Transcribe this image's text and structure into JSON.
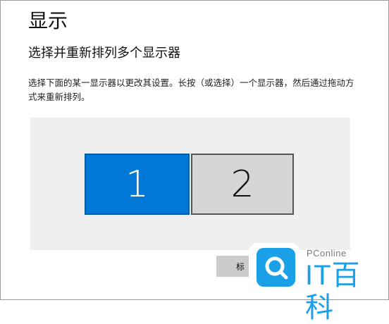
{
  "page": {
    "title": "显示",
    "section_title": "选择并重新排列多个显示器",
    "description": "选择下面的某一显示器以更改其设置。长按（或选择）一个显示器，然后通过拖动方式来重新排列。"
  },
  "monitors": [
    {
      "label": "1",
      "selected": true,
      "color": "#0078d7"
    },
    {
      "label": "2",
      "selected": false,
      "color": "#d6d6d6"
    }
  ],
  "buttons": {
    "identify_label": "标"
  },
  "watermark": {
    "brand": "PConline",
    "logo_text": "IT百科",
    "icon": "search-icon",
    "color": "#1aa0e6"
  }
}
